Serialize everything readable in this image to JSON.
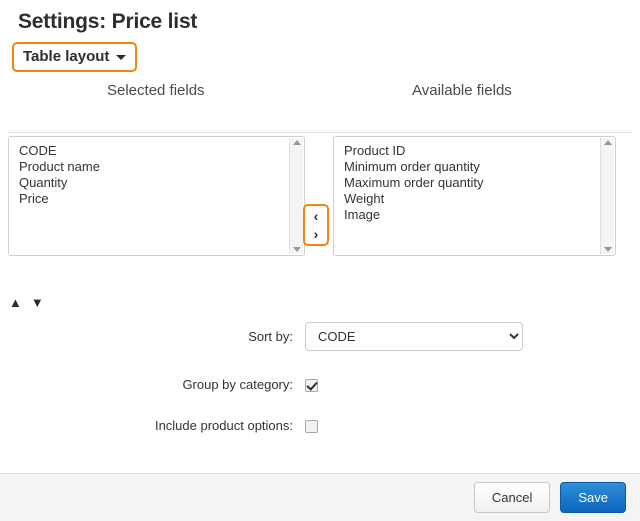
{
  "page_title": "Settings: Price list",
  "layout_switcher": {
    "label": "Table layout",
    "caret_icon": "chevron-down-icon"
  },
  "columns": {
    "selected_header": "Selected fields",
    "available_header": "Available fields"
  },
  "selected_fields": [
    "CODE",
    "Product name",
    "Quantity",
    "Price"
  ],
  "available_fields": [
    "Product ID",
    "Minimum order quantity",
    "Maximum order quantity",
    "Weight",
    "Image"
  ],
  "transfer": {
    "move_left_label": "‹",
    "move_right_label": "›",
    "move_left_icon": "chevron-left-icon",
    "move_right_icon": "chevron-right-icon"
  },
  "reorder": {
    "move_up_label": "▲",
    "move_down_label": "▼",
    "move_up_icon": "chevron-up-icon",
    "move_down_icon": "chevron-down-icon"
  },
  "form": {
    "sort_by_label": "Sort by:",
    "sort_by_value": "CODE",
    "group_by_category_label": "Group by category:",
    "group_by_category_checked": true,
    "include_product_options_label": "Include product options:",
    "include_product_options_checked": false
  },
  "footer": {
    "cancel_label": "Cancel",
    "save_label": "Save"
  },
  "colors": {
    "focus_ring": "#f0860a",
    "save_button": "#0c65bd",
    "title_text": "#2e2e2e",
    "border": "#cfcfcf"
  }
}
